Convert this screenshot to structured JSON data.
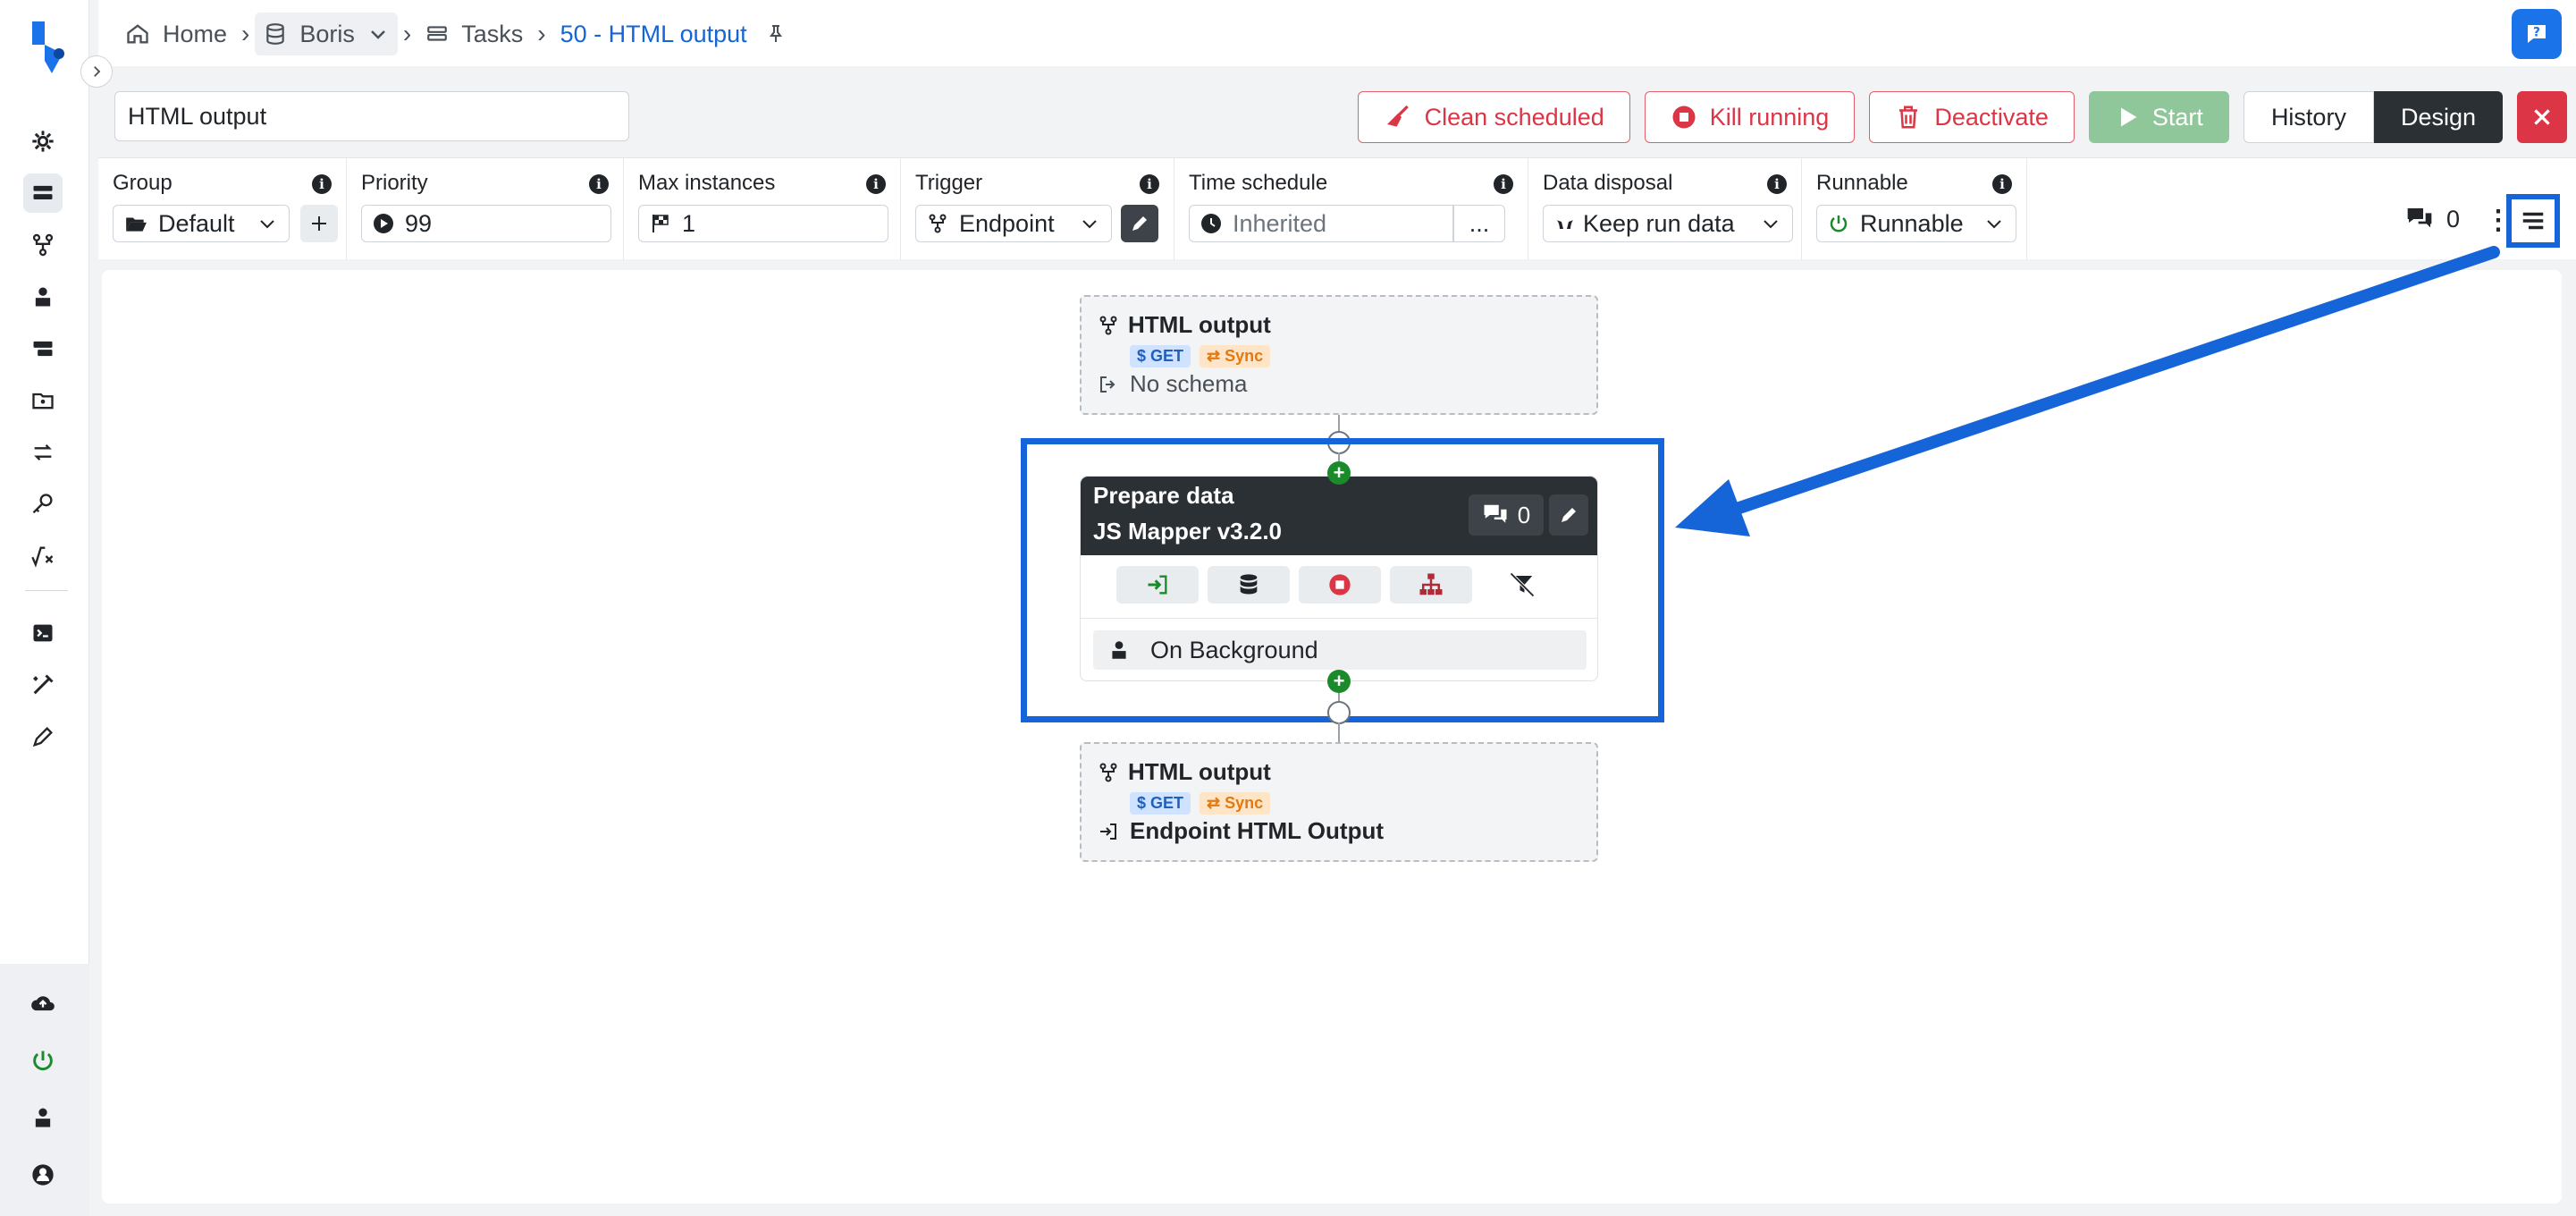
{
  "breadcrumb": {
    "home": "Home",
    "workspace": "Boris",
    "tasks": "Tasks",
    "current": "50 - HTML output"
  },
  "task": {
    "name": "HTML output"
  },
  "actions": {
    "clean_scheduled": "Clean scheduled",
    "kill_running": "Kill running",
    "deactivate": "Deactivate",
    "start": "Start",
    "history": "History",
    "design": "Design"
  },
  "fields": {
    "group": {
      "label": "Group",
      "value": "Default"
    },
    "priority": {
      "label": "Priority",
      "value": "99"
    },
    "max_instances": {
      "label": "Max instances",
      "value": "1"
    },
    "trigger": {
      "label": "Trigger",
      "value": "Endpoint"
    },
    "time_schedule": {
      "label": "Time schedule",
      "value": "Inherited",
      "more": "..."
    },
    "data_disposal": {
      "label": "Data disposal",
      "value": "Keep run data"
    },
    "runnable": {
      "label": "Runnable",
      "value": "Runnable"
    },
    "comments_count": "0"
  },
  "flow": {
    "start_node": {
      "title": "HTML output",
      "method": "$ GET",
      "mode": "⇄ Sync",
      "schema": "No schema"
    },
    "step": {
      "name": "Prepare data",
      "type": "JS Mapper v3.2.0",
      "comments": "0",
      "agent": "On Background"
    },
    "end_node": {
      "title": "HTML output",
      "method": "$ GET",
      "mode": "⇄ Sync",
      "output": "Endpoint HTML Output"
    }
  },
  "colors": {
    "accent": "#1565d8",
    "danger": "#dc3545",
    "success": "#1a8a2a",
    "dark": "#2b3035"
  }
}
